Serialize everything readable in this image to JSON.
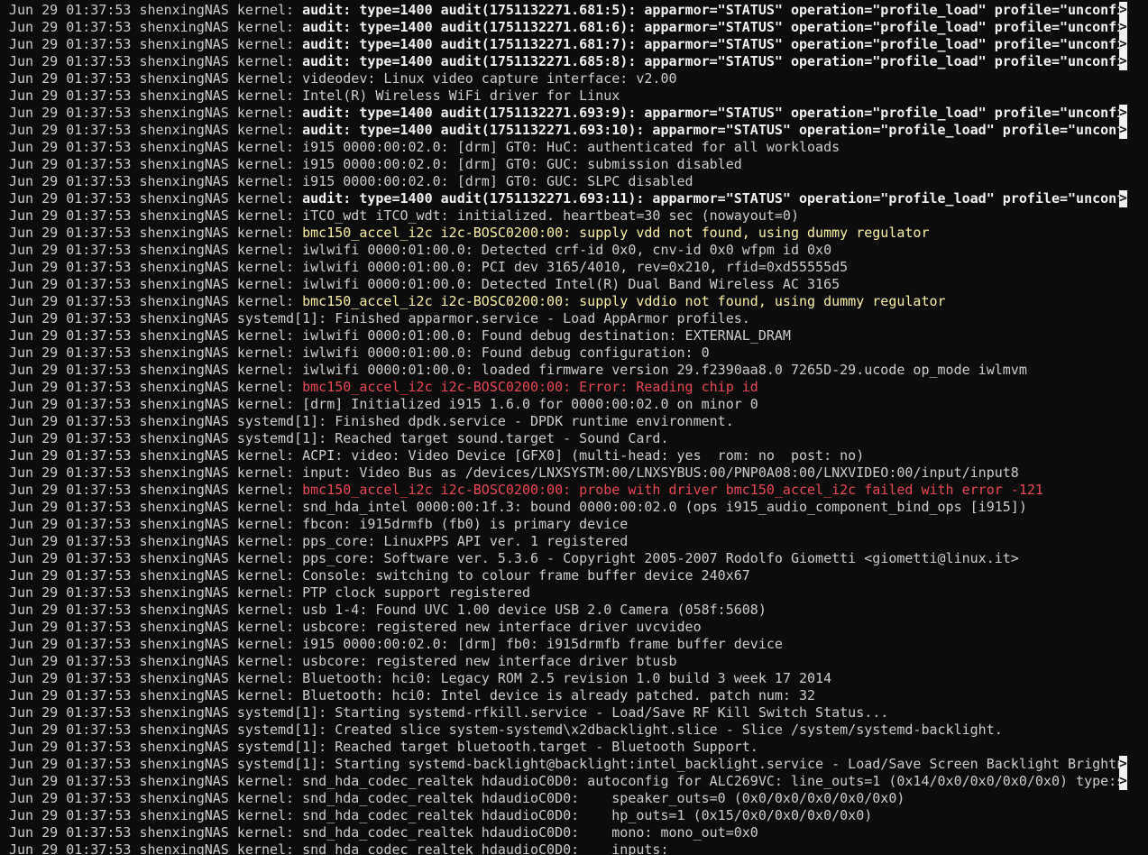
{
  "terminal": {
    "lines": [
      {
        "p": "Jun 29 01:37:53 shenxingNAS kernel: ",
        "m": "audit: type=1400 audit(1751132271.681:5): apparmor=\"STATUS\" operation=\"profile_load\" profile=\"unconfi",
        "s": "bold",
        "t": true
      },
      {
        "p": "Jun 29 01:37:53 shenxingNAS kernel: ",
        "m": "audit: type=1400 audit(1751132271.681:6): apparmor=\"STATUS\" operation=\"profile_load\" profile=\"unconfi",
        "s": "bold",
        "t": true
      },
      {
        "p": "Jun 29 01:37:53 shenxingNAS kernel: ",
        "m": "audit: type=1400 audit(1751132271.681:7): apparmor=\"STATUS\" operation=\"profile_load\" profile=\"unconfi",
        "s": "bold",
        "t": true
      },
      {
        "p": "Jun 29 01:37:53 shenxingNAS kernel: ",
        "m": "audit: type=1400 audit(1751132271.685:8): apparmor=\"STATUS\" operation=\"profile_load\" profile=\"unconfi",
        "s": "bold",
        "t": true
      },
      {
        "p": "Jun 29 01:37:53 shenxingNAS kernel: ",
        "m": "videodev: Linux video capture interface: v2.00",
        "s": "normal",
        "t": false
      },
      {
        "p": "Jun 29 01:37:53 shenxingNAS kernel: ",
        "m": "Intel(R) Wireless WiFi driver for Linux",
        "s": "normal",
        "t": false
      },
      {
        "p": "Jun 29 01:37:53 shenxingNAS kernel: ",
        "m": "audit: type=1400 audit(1751132271.693:9): apparmor=\"STATUS\" operation=\"profile_load\" profile=\"unconfi",
        "s": "bold",
        "t": true
      },
      {
        "p": "Jun 29 01:37:53 shenxingNAS kernel: ",
        "m": "audit: type=1400 audit(1751132271.693:10): apparmor=\"STATUS\" operation=\"profile_load\" profile=\"unconf",
        "s": "bold",
        "t": true
      },
      {
        "p": "Jun 29 01:37:53 shenxingNAS kernel: ",
        "m": "i915 0000:00:02.0: [drm] GT0: HuC: authenticated for all workloads",
        "s": "normal",
        "t": false
      },
      {
        "p": "Jun 29 01:37:53 shenxingNAS kernel: ",
        "m": "i915 0000:00:02.0: [drm] GT0: GUC: submission disabled",
        "s": "normal",
        "t": false
      },
      {
        "p": "Jun 29 01:37:53 shenxingNAS kernel: ",
        "m": "i915 0000:00:02.0: [drm] GT0: GUC: SLPC disabled",
        "s": "normal",
        "t": false
      },
      {
        "p": "Jun 29 01:37:53 shenxingNAS kernel: ",
        "m": "audit: type=1400 audit(1751132271.693:11): apparmor=\"STATUS\" operation=\"profile_load\" profile=\"unconf",
        "s": "bold",
        "t": true
      },
      {
        "p": "Jun 29 01:37:53 shenxingNAS kernel: ",
        "m": "iTCO_wdt iTCO_wdt: initialized. heartbeat=30 sec (nowayout=0)",
        "s": "normal",
        "t": false
      },
      {
        "p": "Jun 29 01:37:53 shenxingNAS kernel: ",
        "m": "bmc150_accel_i2c i2c-BOSC0200:00: supply vdd not found, using dummy regulator",
        "s": "warn",
        "t": false
      },
      {
        "p": "Jun 29 01:37:53 shenxingNAS kernel: ",
        "m": "iwlwifi 0000:01:00.0: Detected crf-id 0x0, cnv-id 0x0 wfpm id 0x0",
        "s": "normal",
        "t": false
      },
      {
        "p": "Jun 29 01:37:53 shenxingNAS kernel: ",
        "m": "iwlwifi 0000:01:00.0: PCI dev 3165/4010, rev=0x210, rfid=0xd55555d5",
        "s": "normal",
        "t": false
      },
      {
        "p": "Jun 29 01:37:53 shenxingNAS kernel: ",
        "m": "iwlwifi 0000:01:00.0: Detected Intel(R) Dual Band Wireless AC 3165",
        "s": "normal",
        "t": false
      },
      {
        "p": "Jun 29 01:37:53 shenxingNAS kernel: ",
        "m": "bmc150_accel_i2c i2c-BOSC0200:00: supply vddio not found, using dummy regulator",
        "s": "warn",
        "t": false
      },
      {
        "p": "Jun 29 01:37:53 shenxingNAS systemd[1]: ",
        "m": "Finished apparmor.service - Load AppArmor profiles.",
        "s": "normal",
        "t": false
      },
      {
        "p": "Jun 29 01:37:53 shenxingNAS kernel: ",
        "m": "iwlwifi 0000:01:00.0: Found debug destination: EXTERNAL_DRAM",
        "s": "normal",
        "t": false
      },
      {
        "p": "Jun 29 01:37:53 shenxingNAS kernel: ",
        "m": "iwlwifi 0000:01:00.0: Found debug configuration: 0",
        "s": "normal",
        "t": false
      },
      {
        "p": "Jun 29 01:37:53 shenxingNAS kernel: ",
        "m": "iwlwifi 0000:01:00.0: loaded firmware version 29.f2390aa8.0 7265D-29.ucode op_mode iwlmvm",
        "s": "normal",
        "t": false
      },
      {
        "p": "Jun 29 01:37:53 shenxingNAS kernel: ",
        "m": "bmc150_accel_i2c i2c-BOSC0200:00: Error: Reading chip id",
        "s": "error",
        "t": false
      },
      {
        "p": "Jun 29 01:37:53 shenxingNAS kernel: ",
        "m": "[drm] Initialized i915 1.6.0 for 0000:00:02.0 on minor 0",
        "s": "normal",
        "t": false
      },
      {
        "p": "Jun 29 01:37:53 shenxingNAS systemd[1]: ",
        "m": "Finished dpdk.service - DPDK runtime environment.",
        "s": "normal",
        "t": false
      },
      {
        "p": "Jun 29 01:37:53 shenxingNAS systemd[1]: ",
        "m": "Reached target sound.target - Sound Card.",
        "s": "normal",
        "t": false
      },
      {
        "p": "Jun 29 01:37:53 shenxingNAS kernel: ",
        "m": "ACPI: video: Video Device [GFX0] (multi-head: yes  rom: no  post: no)",
        "s": "normal",
        "t": false
      },
      {
        "p": "Jun 29 01:37:53 shenxingNAS kernel: ",
        "m": "input: Video Bus as /devices/LNXSYSTM:00/LNXSYBUS:00/PNP0A08:00/LNXVIDEO:00/input/input8",
        "s": "normal",
        "t": false
      },
      {
        "p": "Jun 29 01:37:53 shenxingNAS kernel: ",
        "m": "bmc150_accel_i2c i2c-BOSC0200:00: probe with driver bmc150_accel_i2c failed with error -121",
        "s": "error",
        "t": false
      },
      {
        "p": "Jun 29 01:37:53 shenxingNAS kernel: ",
        "m": "snd_hda_intel 0000:00:1f.3: bound 0000:00:02.0 (ops i915_audio_component_bind_ops [i915])",
        "s": "normal",
        "t": false
      },
      {
        "p": "Jun 29 01:37:53 shenxingNAS kernel: ",
        "m": "fbcon: i915drmfb (fb0) is primary device",
        "s": "normal",
        "t": false
      },
      {
        "p": "Jun 29 01:37:53 shenxingNAS kernel: ",
        "m": "pps_core: LinuxPPS API ver. 1 registered",
        "s": "normal",
        "t": false
      },
      {
        "p": "Jun 29 01:37:53 shenxingNAS kernel: ",
        "m": "pps_core: Software ver. 5.3.6 - Copyright 2005-2007 Rodolfo Giometti <giometti@linux.it>",
        "s": "normal",
        "t": false
      },
      {
        "p": "Jun 29 01:37:53 shenxingNAS kernel: ",
        "m": "Console: switching to colour frame buffer device 240x67",
        "s": "normal",
        "t": false
      },
      {
        "p": "Jun 29 01:37:53 shenxingNAS kernel: ",
        "m": "PTP clock support registered",
        "s": "normal",
        "t": false
      },
      {
        "p": "Jun 29 01:37:53 shenxingNAS kernel: ",
        "m": "usb 1-4: Found UVC 1.00 device USB 2.0 Camera (058f:5608)",
        "s": "normal",
        "t": false
      },
      {
        "p": "Jun 29 01:37:53 shenxingNAS kernel: ",
        "m": "usbcore: registered new interface driver uvcvideo",
        "s": "normal",
        "t": false
      },
      {
        "p": "Jun 29 01:37:53 shenxingNAS kernel: ",
        "m": "i915 0000:00:02.0: [drm] fb0: i915drmfb frame buffer device",
        "s": "normal",
        "t": false
      },
      {
        "p": "Jun 29 01:37:53 shenxingNAS kernel: ",
        "m": "usbcore: registered new interface driver btusb",
        "s": "normal",
        "t": false
      },
      {
        "p": "Jun 29 01:37:53 shenxingNAS kernel: ",
        "m": "Bluetooth: hci0: Legacy ROM 2.5 revision 1.0 build 3 week 17 2014",
        "s": "normal",
        "t": false
      },
      {
        "p": "Jun 29 01:37:53 shenxingNAS kernel: ",
        "m": "Bluetooth: hci0: Intel device is already patched. patch num: 32",
        "s": "normal",
        "t": false
      },
      {
        "p": "Jun 29 01:37:53 shenxingNAS systemd[1]: ",
        "m": "Starting systemd-rfkill.service - Load/Save RF Kill Switch Status...",
        "s": "normal",
        "t": false
      },
      {
        "p": "Jun 29 01:37:53 shenxingNAS systemd[1]: ",
        "m": "Created slice system-systemd\\x2dbacklight.slice - Slice /system/systemd-backlight.",
        "s": "normal",
        "t": false
      },
      {
        "p": "Jun 29 01:37:53 shenxingNAS systemd[1]: ",
        "m": "Reached target bluetooth.target - Bluetooth Support.",
        "s": "normal",
        "t": false
      },
      {
        "p": "Jun 29 01:37:53 shenxingNAS systemd[1]: ",
        "m": "Starting systemd-backlight@backlight:intel_backlight.service - Load/Save Screen Backlight Brightn",
        "s": "normal",
        "t": true
      },
      {
        "p": "Jun 29 01:37:53 shenxingNAS kernel: ",
        "m": "snd_hda_codec_realtek hdaudioC0D0: autoconfig for ALC269VC: line_outs=1 (0x14/0x0/0x0/0x0/0x0) type:s",
        "s": "normal",
        "t": true
      },
      {
        "p": "Jun 29 01:37:53 shenxingNAS kernel: ",
        "m": "snd_hda_codec_realtek hdaudioC0D0:    speaker_outs=0 (0x0/0x0/0x0/0x0/0x0)",
        "s": "normal",
        "t": false
      },
      {
        "p": "Jun 29 01:37:53 shenxingNAS kernel: ",
        "m": "snd_hda_codec_realtek hdaudioC0D0:    hp_outs=1 (0x15/0x0/0x0/0x0/0x0)",
        "s": "normal",
        "t": false
      },
      {
        "p": "Jun 29 01:37:53 shenxingNAS kernel: ",
        "m": "snd_hda_codec_realtek hdaudioC0D0:    mono: mono_out=0x0",
        "s": "normal",
        "t": false
      },
      {
        "p": "Jun 29 01:37:53 shenxingNAS kernel: ",
        "m": "snd_hda_codec_realtek hdaudioC0D0:    inputs:",
        "s": "normal",
        "t": false
      }
    ],
    "truncation_marker": ">",
    "colors": {
      "background": "#0c0c0c",
      "foreground": "#cccccc",
      "bold": "#f2f2f2",
      "warning": "#f9f1a5",
      "error": "#e74856"
    }
  }
}
